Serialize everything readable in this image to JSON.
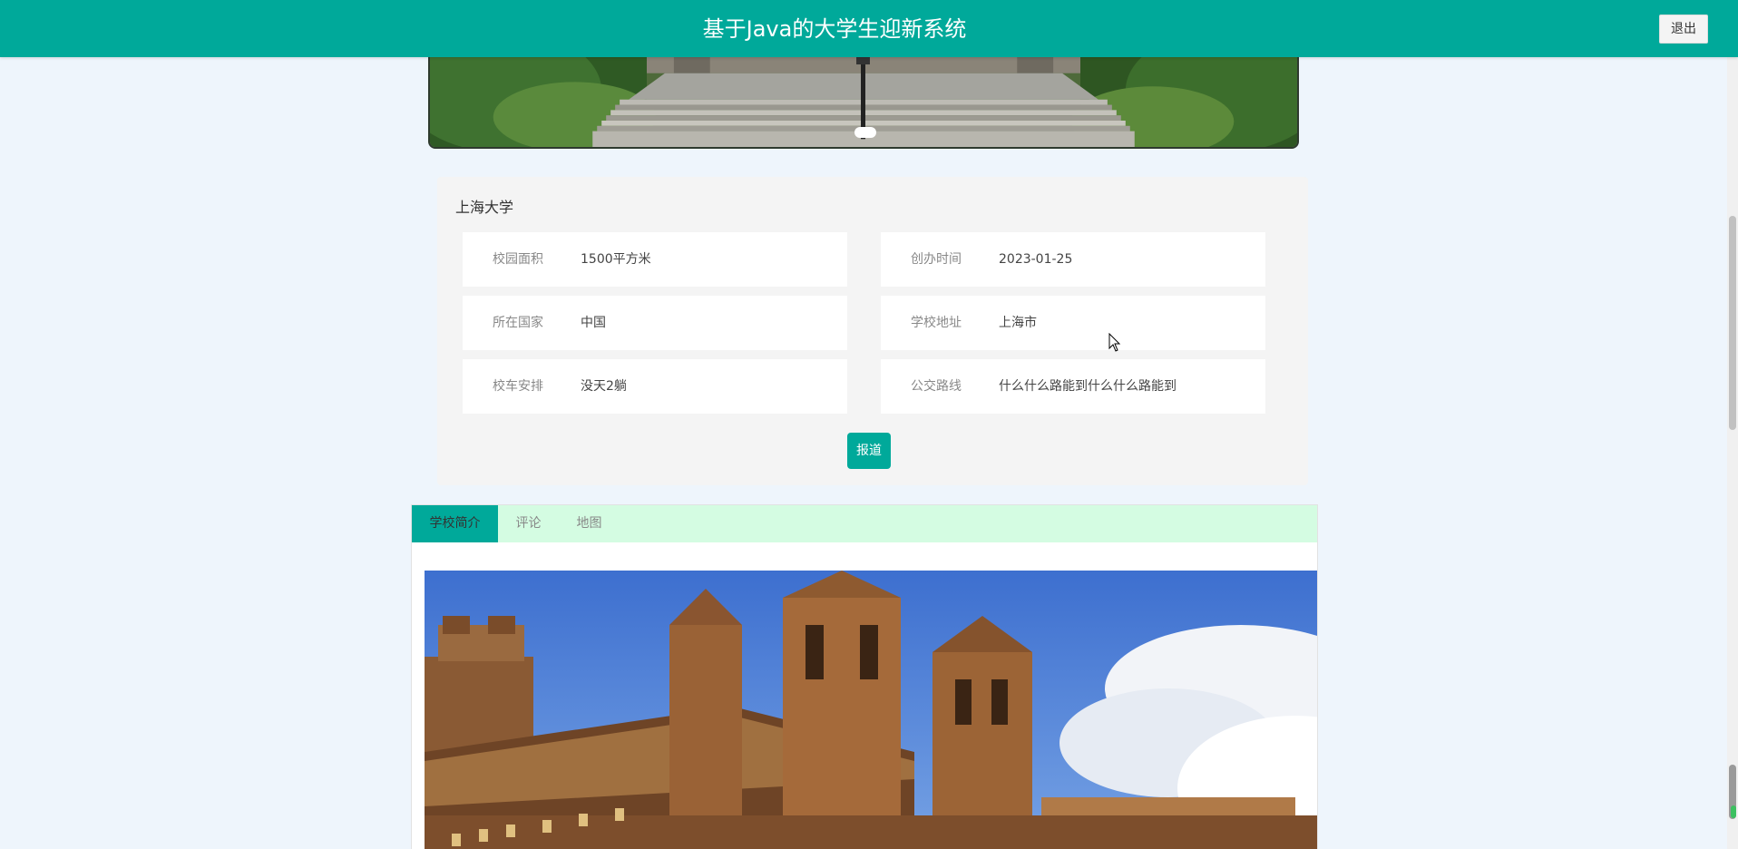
{
  "header": {
    "title": "基于Java的大学生迎新系统",
    "logout_label": "退出",
    "color": "#00a99a"
  },
  "carousel": {
    "active_index": 0,
    "image_icon": "campus-stairs-image"
  },
  "school": {
    "name": "上海大学",
    "fields": [
      {
        "label": "校园面积",
        "value": "1500平方米"
      },
      {
        "label": "创办时间",
        "value": "2023-01-25"
      },
      {
        "label": "所在国家",
        "value": "中国"
      },
      {
        "label": "学校地址",
        "value": "上海市"
      },
      {
        "label": "校车安排",
        "value": "没天2躺"
      },
      {
        "label": "公交路线",
        "value": "什么什么路能到什么什么路能到"
      }
    ],
    "report_label": "报道"
  },
  "tabs": [
    {
      "label": "学校简介",
      "active": true
    },
    {
      "label": "评论",
      "active": false
    },
    {
      "label": "地图",
      "active": false
    }
  ],
  "intro_image_icon": "gothic-building-image"
}
